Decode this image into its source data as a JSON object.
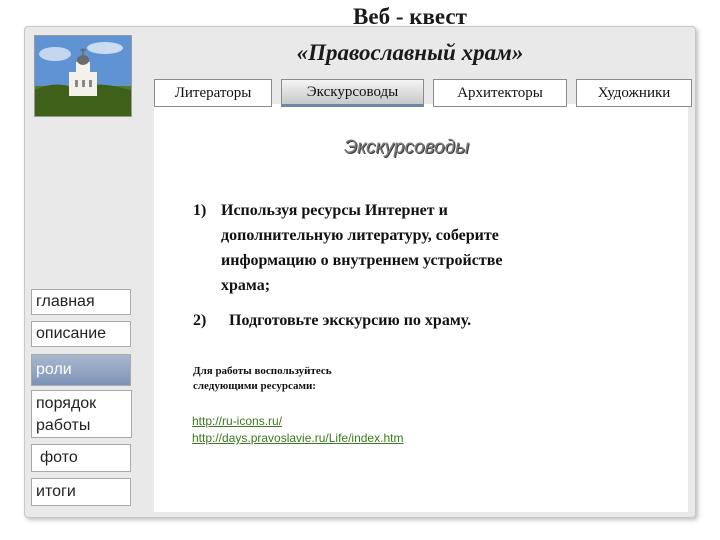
{
  "header": {
    "title_line1": "Веб - квест",
    "title_line2": "«Православный храм»"
  },
  "tabs": [
    {
      "label": "Литераторы",
      "active": false
    },
    {
      "label": "Экскурсоводы",
      "active": true
    },
    {
      "label": "Архитекторы",
      "active": false
    },
    {
      "label": "Художники",
      "active": false
    }
  ],
  "main": {
    "section_heading": "Экскурсоводы",
    "tasks": [
      {
        "number": "1)",
        "text_lines": [
          "Используя ресурсы Интернет и",
          "дополнительную литературу, соберите",
          "информацию о внутреннем устройстве",
          "храма;"
        ]
      },
      {
        "number": "2)",
        "text_lines": [
          "Подготовьте экскурсию по храму."
        ]
      }
    ],
    "resources_note_lines": [
      "Для работы воспользуйтесь",
      "следующими ресурсами:"
    ],
    "links": [
      "http://ru-icons.ru/",
      "http://days.pravoslavie.ru/Life/index.htm"
    ]
  },
  "sidebar": {
    "items": [
      {
        "label": "главная",
        "active": false
      },
      {
        "label": "описание",
        "active": false
      },
      {
        "label": "роли",
        "active": true
      },
      {
        "label": "порядок работы",
        "active": false
      },
      {
        "label": "фото",
        "active": false
      },
      {
        "label": "итоги",
        "active": false
      }
    ]
  }
}
